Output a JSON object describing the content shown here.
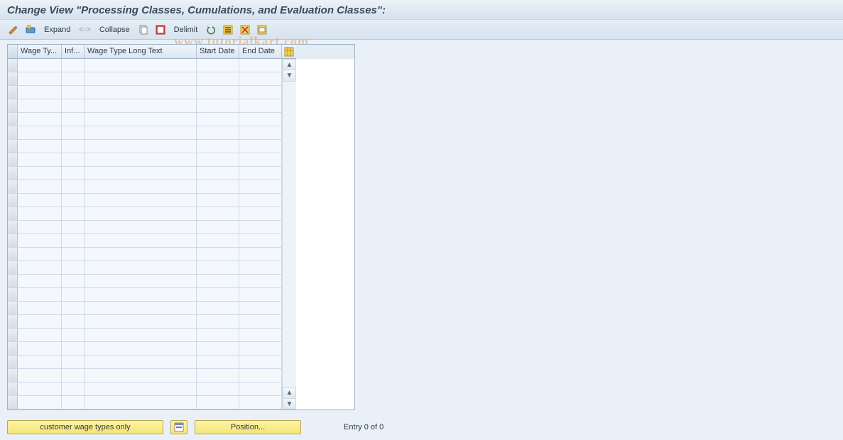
{
  "title": "Change View \"Processing Classes, Cumulations, and Evaluation Classes\":",
  "toolbar": {
    "expand_label": "Expand",
    "sep": "<->",
    "collapse_label": "Collapse",
    "delimit_label": "Delimit"
  },
  "columns": {
    "wage_type": "Wage Ty...",
    "inf": "Inf...",
    "long_text": "Wage Type Long Text",
    "start_date": "Start Date",
    "end_date": "End Date"
  },
  "rows_count": 26,
  "footer": {
    "customer_btn": "customer wage types only",
    "position_btn": "Position...",
    "entry_text": "Entry 0 of 0"
  },
  "watermark": "www.tutorialkart.com"
}
